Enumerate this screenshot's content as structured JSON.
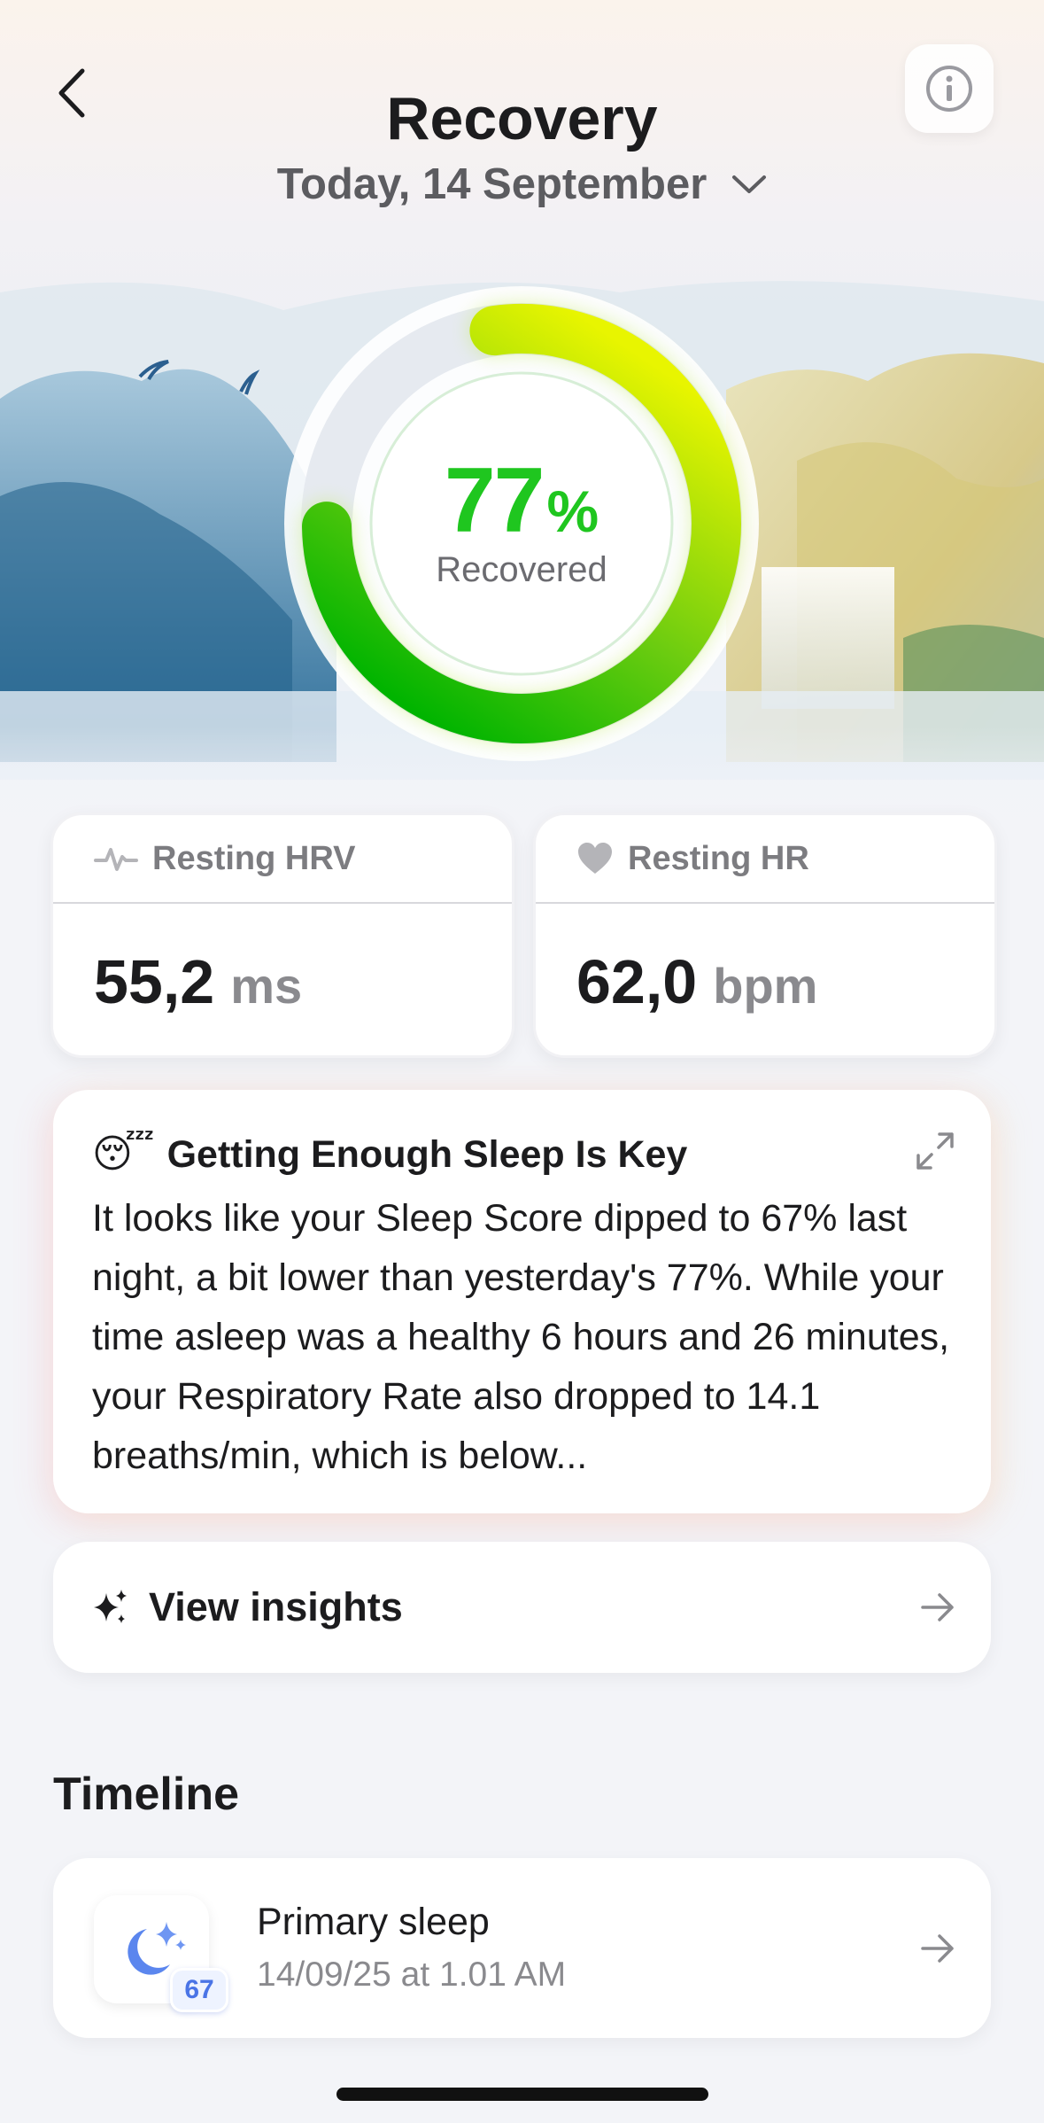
{
  "header": {
    "title": "Recovery",
    "date_label": "Today, 14 September",
    "back_icon": "chevron-left-icon",
    "info_icon": "info-icon",
    "date_dropdown_icon": "chevron-down-icon"
  },
  "recovery": {
    "percent": 77,
    "percent_text": "77",
    "percent_sign": "%",
    "label": "Recovered",
    "ring_gradient": [
      "#e6f500",
      "#00b400"
    ]
  },
  "metrics": {
    "hrv": {
      "label": "Resting HRV",
      "value": "55,2",
      "unit": "ms",
      "icon": "pulse-icon"
    },
    "hr": {
      "label": "Resting HR",
      "value": "62,0",
      "unit": "bpm",
      "icon": "heart-icon"
    }
  },
  "insight": {
    "emoji": "😴",
    "title": "Getting Enough Sleep Is Key",
    "body": "It looks like your Sleep Score dipped to 67% last night, a bit lower than yesterday's 77%. While your time asleep was a healthy 6 hours and 26 minutes, your Respiratory Rate also dropped to 14.1 breaths/min, which is below...",
    "expand_icon": "expand-icon"
  },
  "view_insights": {
    "label": "View insights",
    "icon": "sparkles-icon",
    "arrow_icon": "arrow-right-icon"
  },
  "timeline": {
    "title": "Timeline",
    "items": [
      {
        "name": "Primary sleep",
        "time": "14/09/25 at 1.01 AM",
        "score": "67",
        "icon": "moon-stars-icon"
      }
    ]
  },
  "colors": {
    "accent_green": "#1fc61f",
    "sleep_blue": "#4a74e6"
  }
}
